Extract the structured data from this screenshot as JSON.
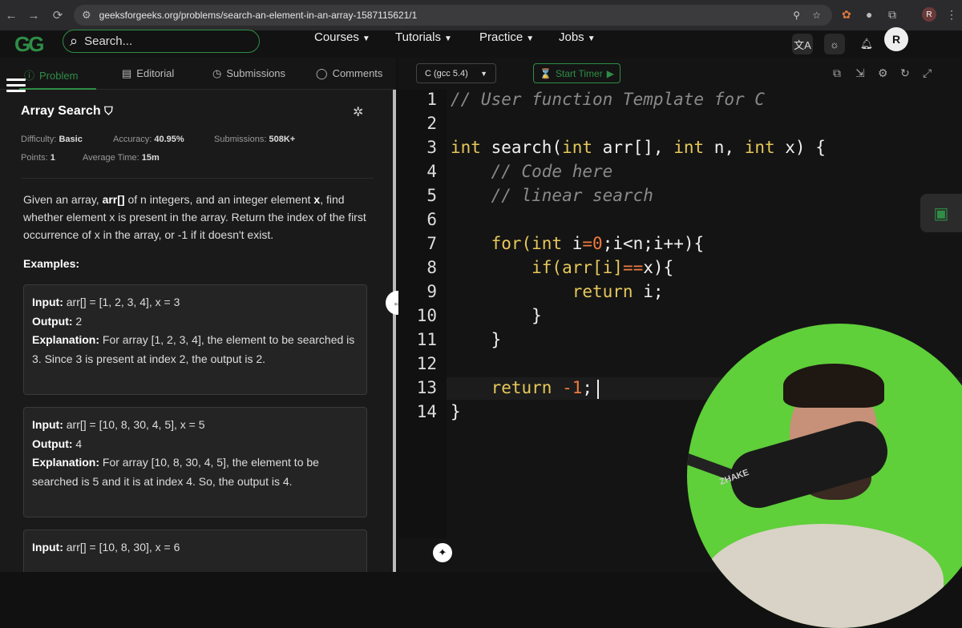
{
  "browser": {
    "url": "geeksforgeeks.org/problems/search-an-element-in-an-array-1587115621/1",
    "profile_initial": "R"
  },
  "header": {
    "search_placeholder": "Search...",
    "menu": [
      "Courses",
      "Tutorials",
      "Practice",
      "Jobs"
    ],
    "user_initial": "R"
  },
  "left": {
    "tabs": [
      "Problem",
      "Editorial",
      "Submissions",
      "Comments"
    ],
    "title": "Array Search",
    "meta": {
      "difficulty_label": "Difficulty:",
      "difficulty": "Basic",
      "accuracy_label": "Accuracy:",
      "accuracy": "40.95%",
      "submissions_label": "Submissions:",
      "submissions": "508K+",
      "points_label": "Points:",
      "points": "1",
      "avg_time_label": "Average Time:",
      "avg_time": "15m"
    },
    "description": {
      "p1": "Given an array, ",
      "arr": "arr[]",
      "p2": " of n integers, and an integer element ",
      "x": "x",
      "p3": ", find whether element x is present in the array. Return the index of the first occurrence of x in the array, or -1 if it doesn't exist."
    },
    "examples_label": "Examples:",
    "examples": [
      {
        "input_label": "Input:",
        "input": " arr[] = [1, 2, 3, 4], x = 3",
        "output_label": "Output:",
        "output": " 2",
        "explanation_label": "Explanation:",
        "explanation": " For array [1, 2, 3, 4], the element to be searched is 3. Since 3 is present at index 2, the output is 2."
      },
      {
        "input_label": "Input:",
        "input": " arr[] = [10, 8, 30, 4, 5], x = 5",
        "output_label": "Output:",
        "output": " 4",
        "explanation_label": "Explanation:",
        "explanation": " For array [10, 8, 30, 4, 5], the element to be searched is 5 and it is at index 4. So, the output is 4."
      },
      {
        "input_label": "Input:",
        "input": " arr[] = [10, 8, 30], x = 6"
      }
    ]
  },
  "editor": {
    "language": "C (gcc 5.4)",
    "timer_label": "Start Timer",
    "line_numbers": [
      "1",
      "2",
      "3",
      "4",
      "5",
      "6",
      "7",
      "8",
      "9",
      "10",
      "11",
      "12",
      "13",
      "14"
    ],
    "lines": {
      "l1": "// User function Template for C",
      "l3a": "int",
      "l3b": " search(",
      "l3c": "int",
      "l3d": " arr[], ",
      "l3e": "int",
      "l3f": " n, ",
      "l3g": "int",
      "l3h": " x) {",
      "l4": "    // Code here",
      "l5": "    // linear search",
      "l7a": "    for(",
      "l7b": "int",
      "l7c": " i",
      "l7d": "=0",
      "l7e": ";i<n;i++){",
      "l8a": "        if(arr[i]",
      "l8b": "==",
      "l8c": "x){",
      "l9a": "            ",
      "l9b": "return",
      "l9c": " i;",
      "l10": "        }",
      "l11": "    }",
      "l13a": "    return ",
      "l13b": "-1",
      "l13c": ";",
      "l14": "}"
    }
  },
  "webcam": {
    "mic_brand": "ZHAKE"
  },
  "colors": {
    "accent": "#2f8d46",
    "editor_bg": "#141414",
    "webcam_bg": "#5fcf3a"
  }
}
